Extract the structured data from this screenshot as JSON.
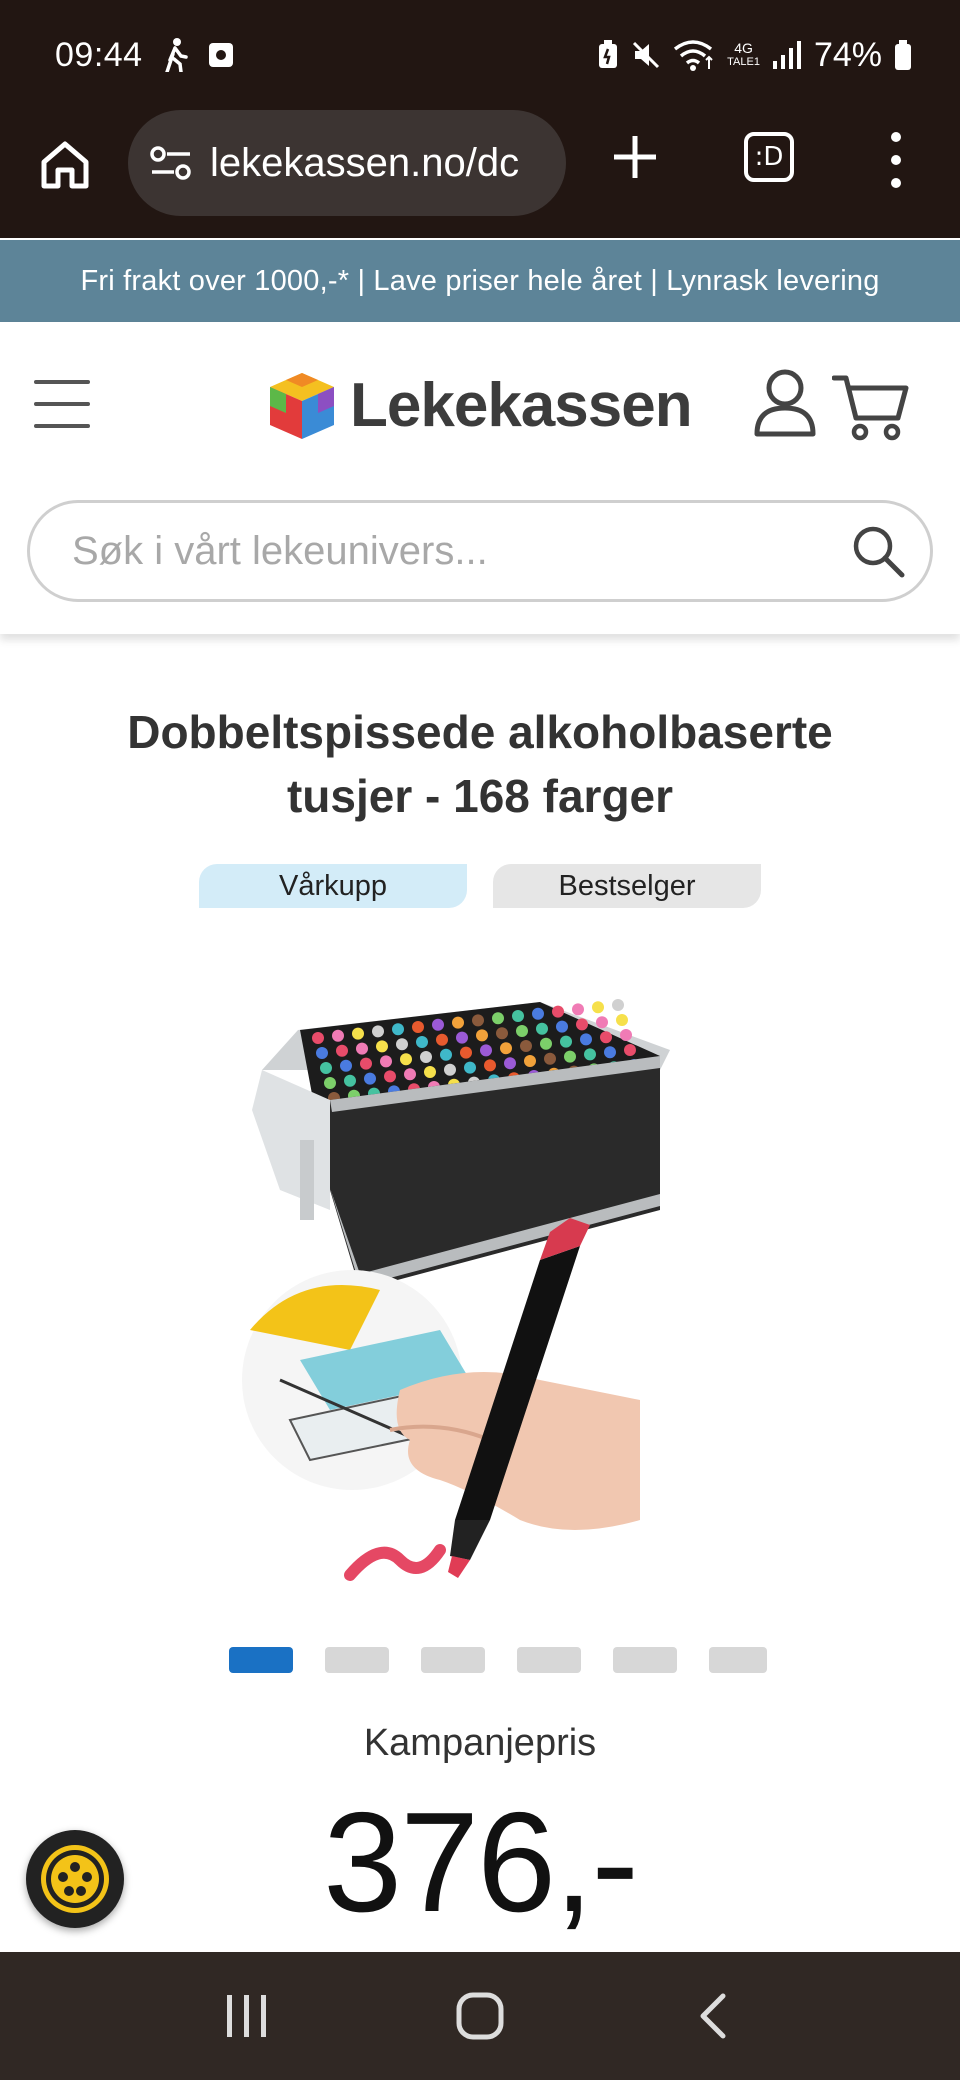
{
  "status_bar": {
    "time": "09:44",
    "battery": "74%",
    "network": "4G",
    "network_sub": "TALE1"
  },
  "browser": {
    "url": "lekekassen.no/dc",
    "tab_count": ":D"
  },
  "promo_banner": {
    "text": "Fri frakt over 1000,-* | Lave priser hele året | Lynrask levering"
  },
  "header": {
    "logo_text": "Lekekassen",
    "search_placeholder": "Søk i vårt lekeunivers..."
  },
  "product": {
    "title": "Dobbeltspissede alkoholbaserte tusjer - 168 farger",
    "badges": [
      "Vårkupp",
      "Bestselger"
    ],
    "image_count": 6,
    "active_image_index": 0,
    "price_label": "Kampanjepris",
    "price": "376,-"
  },
  "colors": {
    "status_bg": "#221612",
    "banner_bg": "#5d8498",
    "badge_var_bg": "#d3ecf8",
    "badge_best_bg": "#e6e6e6",
    "dot_active": "#1a71c4",
    "nav_bg": "#302824"
  }
}
